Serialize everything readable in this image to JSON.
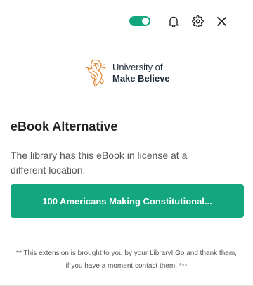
{
  "header": {
    "toggle_on": true,
    "icons": [
      "toggle-switch",
      "bell-icon",
      "gear-icon",
      "close-icon"
    ]
  },
  "logo": {
    "line1": "University of",
    "line2": "Make Believe"
  },
  "main": {
    "title": "eBook Alternative",
    "description": "The library has this eBook in license at a different location.",
    "book_button_label": "100 Americans Making Constitutional..."
  },
  "footer": {
    "note": "** This extension is brought to you by your Library! Go and thank them, if you have a moment contact them. ***"
  },
  "colors": {
    "accent": "#13a67f",
    "logo_orange": "#e08a3a",
    "logo_text": "#1f2d3a"
  }
}
